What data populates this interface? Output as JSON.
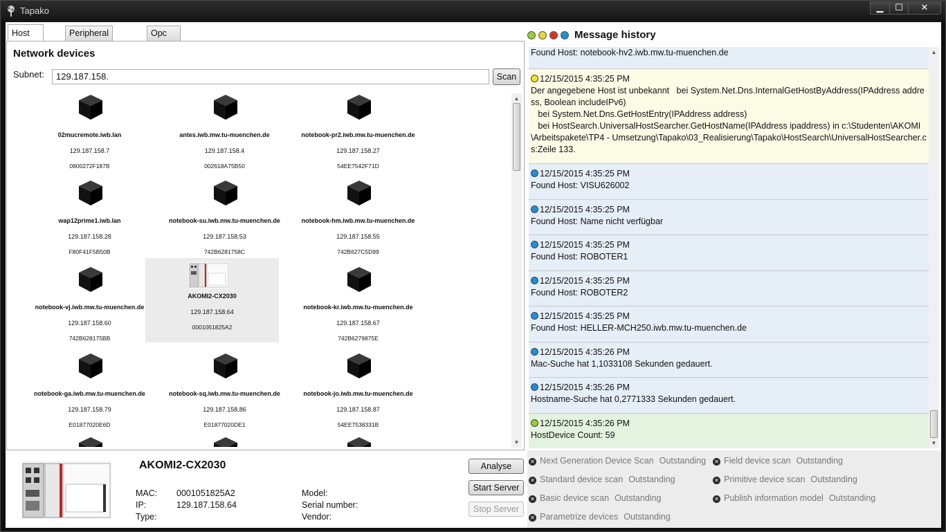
{
  "window": {
    "title": "Tapako",
    "min": "▁",
    "max": "☐",
    "close": "✕"
  },
  "tabs": [
    {
      "label": "Host Search",
      "active": true
    },
    {
      "label": "Peripheral analysis"
    },
    {
      "label": "Opc Ua Server"
    }
  ],
  "network": {
    "title": "Network devices",
    "subnet_label": "Subnet:",
    "subnet_value": "129.187.158.",
    "scan_label": "Scan"
  },
  "devices": [
    {
      "name": "02mucremote.iwb.lan",
      "ip": "129.187.158.7",
      "mac": "0800272F187B"
    },
    {
      "name": "antes.iwb.mw.tu-muenchen.de",
      "ip": "129.187.158.4",
      "mac": "002618A75B50"
    },
    {
      "name": "notebook-pr2.iwb.mw.tu-muenchen.de",
      "ip": "129.187.158.27",
      "mac": "54EE7542F71D"
    },
    {
      "name": "wap12prime1.iwb.lan",
      "ip": "129.187.158.28",
      "mac": "F80F41F5B50B"
    },
    {
      "name": "notebook-su.iwb.mw.tu-muenchen.de",
      "ip": "129.187.158.53",
      "mac": "742B6281758C"
    },
    {
      "name": "notebook-hm.iwb.mw.tu-muenchen.de",
      "ip": "129.187.158.55",
      "mac": "742B627C5D99"
    },
    {
      "name": "notebook-vj.iwb.mw.tu-muenchen.de",
      "ip": "129.187.158.60",
      "mac": "742B628175BB"
    },
    {
      "name": "AKOMI2-CX2030",
      "ip": "129.187.158.64",
      "mac": "0001051825A2",
      "selected": true
    },
    {
      "name": "notebook-kr.iwb.mw.tu-muenchen.de",
      "ip": "129.187.158.67",
      "mac": "742B6279875E"
    },
    {
      "name": "notebook-ga.iwb.mw.tu-muenchen.de",
      "ip": "129.187.158.79",
      "mac": "E01877020E6D"
    },
    {
      "name": "notebook-sq.iwb.mw.tu-muenchen.de",
      "ip": "129.187.158.86",
      "mac": "E01877020DE1"
    },
    {
      "name": "notebook-jo.iwb.mw.tu-muenchen.de",
      "ip": "129.187.158.87",
      "mac": "54EE7538331B"
    }
  ],
  "detail": {
    "name": "AKOMI2-CX2030",
    "mac_label": "MAC:",
    "mac": "0001051825A2",
    "ip_label": "IP:",
    "ip": "129.187.158.64",
    "type_label": "Type:",
    "model_label": "Model:",
    "serial_label": "Serial number:",
    "vendor_label": "Vendor:",
    "analyse": "Analyse",
    "start_server": "Start Server",
    "stop_server": "Stop Server"
  },
  "message_history": {
    "title": "Message history",
    "filter_dots": [
      "#9acd32",
      "#e8d830",
      "#e03020",
      "#1e90d8"
    ],
    "messages": [
      {
        "level": "info",
        "color": "#1e90d8",
        "bg": "#e6eef8",
        "time": "",
        "text": "Found Host: notebook-hv2.iwb.mw.tu-muenchen.de"
      },
      {
        "level": "warning",
        "color": "#f2e52a",
        "bg": "#fbfbe6",
        "time": "12/15/2015 4:35:25 PM",
        "text": "Der angegebene Host ist unbekannt   bei System.Net.Dns.InternalGetHostByAddress(IPAddress address, Boolean includeIPv6)\n   bei System.Net.Dns.GetHostEntry(IPAddress address)\n   bei HostSearch.UniversalHostSearcher.GetHostName(IPAddress ipaddress) in c:\\Studenten\\AKOMI\\Arbeitspakete\\TP4 - Umsetzung\\Tapako\\03_Realisierung\\Tapako\\HostSearch\\UniversalHostSearcher.cs:Zeile 133."
      },
      {
        "level": "info",
        "color": "#1e90d8",
        "bg": "#e6eef8",
        "time": "12/15/2015 4:35:25 PM",
        "text": "Found Host: VISU626002"
      },
      {
        "level": "info",
        "color": "#1e90d8",
        "bg": "#e6eef8",
        "time": "12/15/2015 4:35:25 PM",
        "text": "Found Host: Name nicht verfügbar"
      },
      {
        "level": "info",
        "color": "#1e90d8",
        "bg": "#e6eef8",
        "time": "12/15/2015 4:35:25 PM",
        "text": "Found Host: ROBOTER1"
      },
      {
        "level": "info",
        "color": "#1e90d8",
        "bg": "#e6eef8",
        "time": "12/15/2015 4:35:25 PM",
        "text": "Found Host: ROBOTER2"
      },
      {
        "level": "info",
        "color": "#1e90d8",
        "bg": "#e6eef8",
        "time": "12/15/2015 4:35:25 PM",
        "text": "Found Host: HELLER-MCH250.iwb.mw.tu-muenchen.de"
      },
      {
        "level": "info",
        "color": "#1e90d8",
        "bg": "#e6eef8",
        "time": "12/15/2015 4:35:26 PM",
        "text": "Mac-Suche hat 1,1033108 Sekunden gedauert."
      },
      {
        "level": "info",
        "color": "#1e90d8",
        "bg": "#e6eef8",
        "time": "12/15/2015 4:35:26 PM",
        "text": "Hostname-Suche hat 0,2771333 Sekunden gedauert."
      },
      {
        "level": "success",
        "color": "#9acd32",
        "bg": "#e4f2e0",
        "time": "12/15/2015 4:35:26 PM",
        "text": "HostDevice Count: 59"
      }
    ]
  },
  "scans": [
    {
      "name": "Next Generation Device Scan",
      "status": "Outstanding"
    },
    {
      "name": "Field device scan",
      "status": "Outstanding"
    },
    {
      "name": "Standard device scan",
      "status": "Outstanding"
    },
    {
      "name": "Primitive device scan",
      "status": "Outstanding"
    },
    {
      "name": "Basic device scan",
      "status": "Outstanding"
    },
    {
      "name": "Publish information model",
      "status": "Outstanding"
    },
    {
      "name": "Parametrize devices",
      "status": "Outstanding"
    }
  ]
}
